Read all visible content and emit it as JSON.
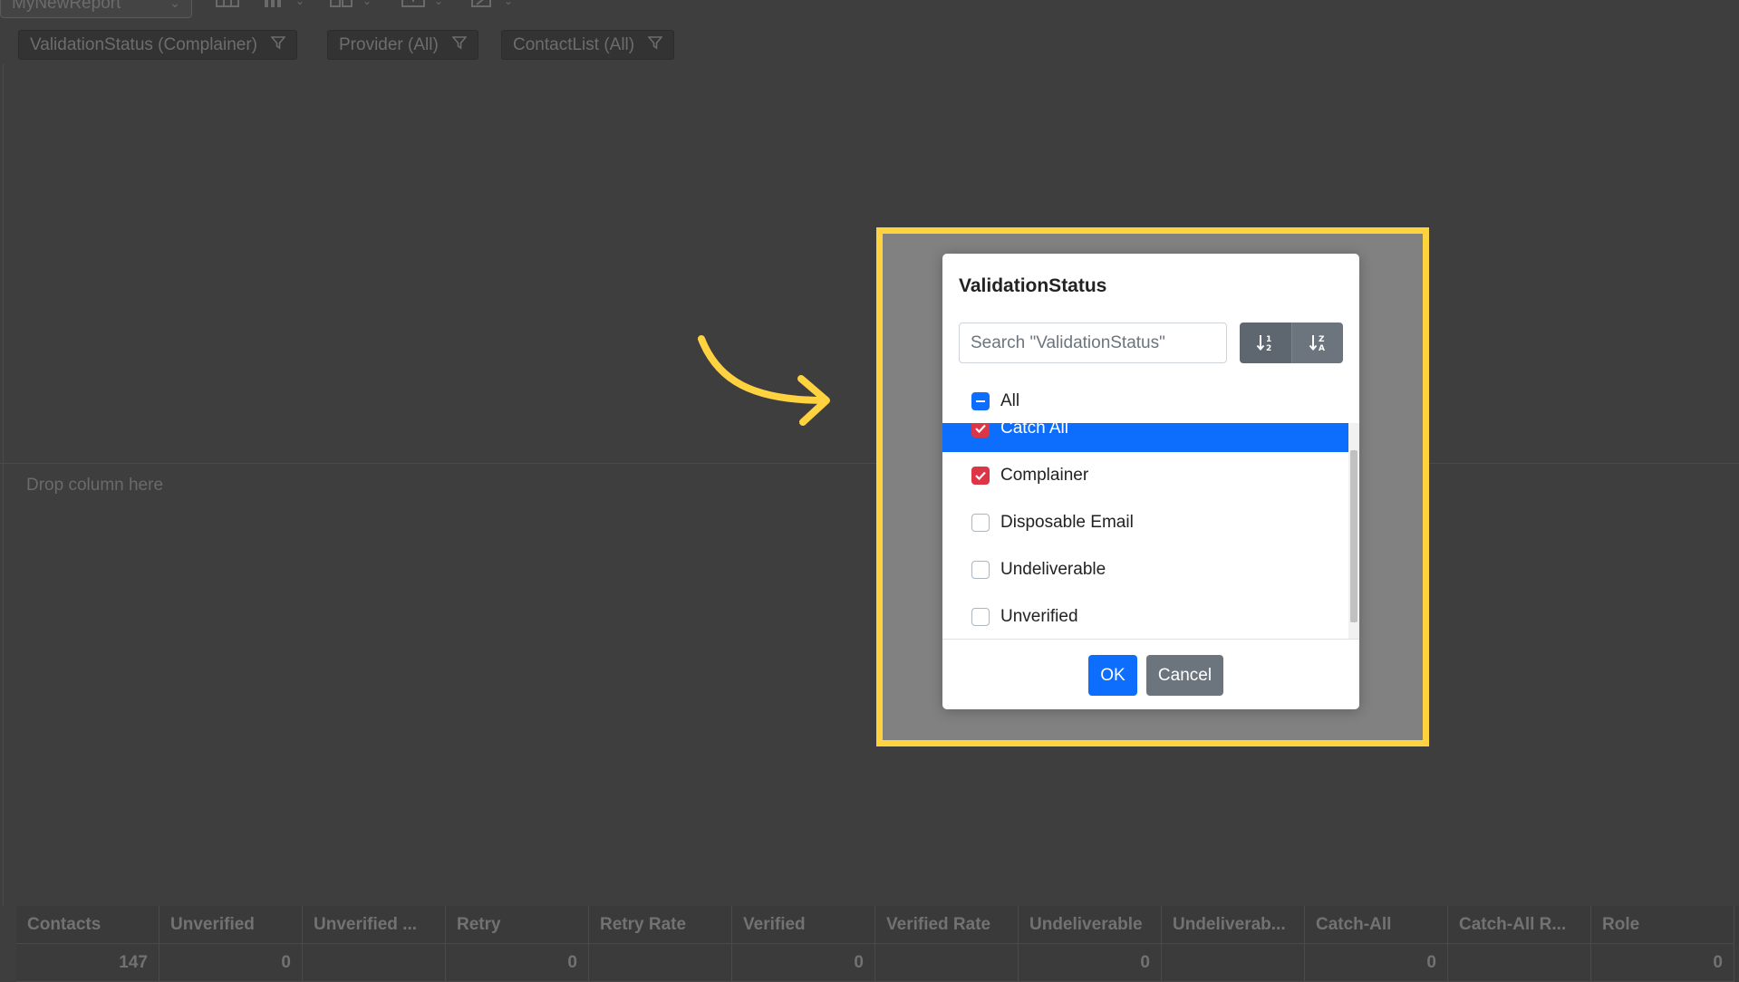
{
  "report": {
    "name": "MyNewReport",
    "toolbar_icons": [
      "table-icon",
      "chart-icon",
      "layout-icon",
      "export-icon",
      "edit-icon"
    ]
  },
  "filters": [
    {
      "label": "ValidationStatus (Complainer)"
    },
    {
      "label": "Provider (All)"
    },
    {
      "label": "ContactList (All)"
    }
  ],
  "drop_zone": {
    "label": "Drop column here"
  },
  "grid": {
    "columns": [
      "Contacts",
      "Unverified",
      "Unverified ...",
      "Retry",
      "Retry Rate",
      "Verified",
      "Verified Rate",
      "Undeliverable",
      "Undeliverab...",
      "Catch-All",
      "Catch-All R...",
      "Role"
    ],
    "values": [
      "147",
      "0",
      "",
      "0",
      "",
      "0",
      "",
      "0",
      "",
      "0",
      "",
      "0"
    ]
  },
  "modal": {
    "title": "ValidationStatus",
    "search_placeholder": "Search \"ValidationStatus\"",
    "sort_asc_icon": "sort-ascending-icon",
    "sort_desc_icon": "sort-descending-icon",
    "all_label": "All",
    "options": [
      {
        "label": "Catch All",
        "checked": true,
        "selected": true
      },
      {
        "label": "Complainer",
        "checked": true,
        "selected": false
      },
      {
        "label": "Disposable Email",
        "checked": false,
        "selected": false
      },
      {
        "label": "Undeliverable",
        "checked": false,
        "selected": false
      },
      {
        "label": "Unverified",
        "checked": false,
        "selected": false
      }
    ],
    "ok_label": "OK",
    "cancel_label": "Cancel"
  },
  "colors": {
    "highlight": "#ffd23f",
    "primary": "#0d6efd",
    "checked": "#dc3545",
    "secondary": "#6c757d"
  }
}
